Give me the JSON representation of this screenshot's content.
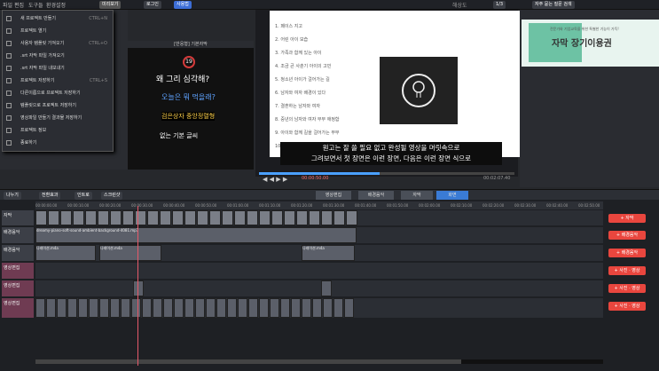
{
  "menu": {
    "file": "파일",
    "edit": "편집",
    "tools": "도구들",
    "settings": "환경설정"
  },
  "toolbar": {
    "preview": "미리보기",
    "login": "로그인",
    "share": "사용법"
  },
  "top_right": {
    "resolution": "해상도",
    "zoom": "1/3",
    "help": "자주 묻는 질문 검색"
  },
  "dropdown_items": [
    {
      "label": "새 프로젝트 만들기",
      "shortcut": "CTRL+N"
    },
    {
      "label": "프로젝트 열기",
      "shortcut": ""
    },
    {
      "label": "사용자 템플릿 가져오기",
      "shortcut": "CTRL+O"
    },
    {
      "label": ".srt 자막 파일 가져오기",
      "shortcut": ""
    },
    {
      "label": ".srt 자막 파일 내보내기",
      "shortcut": ""
    },
    {
      "label": "프로젝트 저장하기",
      "shortcut": "CTRL+S"
    },
    {
      "label": "다른이름으로 프로젝트 저장하기",
      "shortcut": ""
    },
    {
      "label": "템플릿으로 프로젝트 저장하기",
      "shortcut": ""
    },
    {
      "label": "영상파일 만들기 결과물 저장하기",
      "shortcut": ""
    },
    {
      "label": "프로젝트 정보",
      "shortcut": ""
    },
    {
      "label": "종료하기",
      "shortcut": ""
    }
  ],
  "template": {
    "header": "[반응형] 기본자막",
    "number": "19",
    "line1": "왜 그리 심각해?",
    "line2": "오늘은 뭐 먹을래?",
    "line3": "검은상자 중앙정렬형",
    "line4": "없는 기본 글씨"
  },
  "doc": {
    "lines": [
      "1. 페이스 지고",
      "2. 어린 아이 모습",
      "3. 가족과 함께 있는 아이",
      "4. 조금 큰 사춘기 아이의 고민",
      "5. 청소년 아이가 걸어가는 길",
      "6. 남자와 여자 배경이 있다",
      "7. 결혼하는 남자와 여자",
      "8. 중년의 남자와 여자 부부 애정함",
      "9. 아이와 함께 길을 걸어가는 부부",
      "10. 어느 정..."
    ],
    "caption1": "원고는 잘 쓸 필요 없고 완성될 영상을 머릿속으로",
    "caption2": "그려보면서 첫 장면은 이런 장면, 다음은 이런 장면 식으로"
  },
  "player": {
    "time": "00:00:50.00",
    "total": "00:02:07.40"
  },
  "ad": {
    "line1": "전문가와 기업교육을 위한 특별한 기능이 가득!",
    "line2": "자막 장기이용권"
  },
  "midbar": {
    "split": "나누기",
    "add_seg": "전환효과",
    "add_transition": "인트로",
    "screen": "스크린샷"
  },
  "tabs": [
    "영상편집",
    "배경음악",
    "자막",
    "화면"
  ],
  "ruler": [
    "00:00:00.00",
    "00:00:10.00",
    "00:00:20.00",
    "00:00:30.00",
    "00:00:40.00",
    "00:00:50.00",
    "00:01:00.00",
    "00:01:10.00",
    "00:01:20.00",
    "00:01:30.00",
    "00:01:40.00",
    "00:01:50.00",
    "00:02:00.00",
    "00:02:10.00",
    "00:02:20.00",
    "00:02:30.00",
    "00:02:40.00",
    "00:02:50.00"
  ],
  "tracks": [
    {
      "name": "자막",
      "pink": false
    },
    {
      "name": "배경음악",
      "pink": false
    },
    {
      "name": "배경음악",
      "pink": false
    },
    {
      "name": "영상편집",
      "pink": true
    },
    {
      "name": "영상편집",
      "pink": true
    },
    {
      "name": "영상편집",
      "pink": true
    }
  ],
  "music_clip": "dreamy-piano-soft-sound-ambient-background-4081.mp3",
  "narration_clips": [
    "나레이션.m4a",
    "나레이션.m4a",
    "나레이션.m4a"
  ],
  "right_buttons": [
    "+ 자막",
    "+ 배경음악",
    "+ 배경음악",
    "+ 사진 · 영상",
    "+ 사진 · 영상",
    "+ 사진 · 영상"
  ]
}
